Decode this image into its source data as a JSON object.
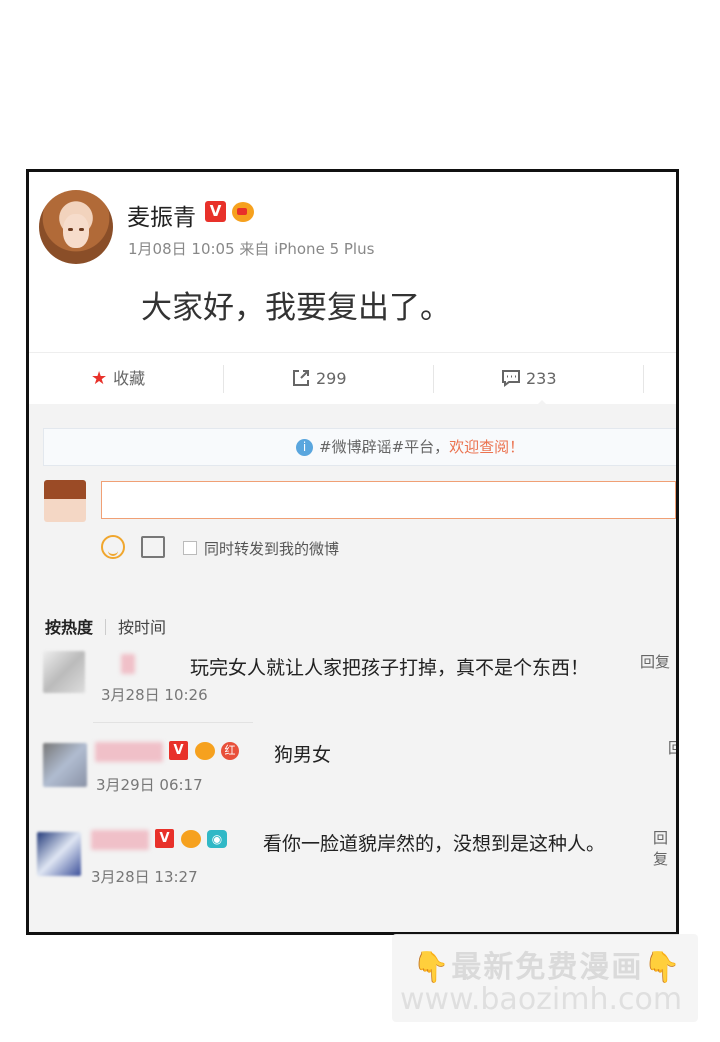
{
  "post": {
    "username": "麦振青",
    "verified_badge": "V",
    "meta": "1月08日 10:05 来自 iPhone 5 Plus",
    "text": "大家好，我要复出了。"
  },
  "actions": {
    "favorite_label": "收藏",
    "repost_count": "299",
    "comment_count": "233"
  },
  "notice": {
    "prefix": "#微博辟谣#平台，",
    "link": "欢迎查阅！"
  },
  "composer": {
    "sync_label": "同时转发到我的微博"
  },
  "sort": {
    "hot": "按热度",
    "time": "按时间"
  },
  "comments": [
    {
      "text": "玩完女人就让人家把孩子打掉，真不是个东西！",
      "time": "3月28日 10:26",
      "reply": "回复"
    },
    {
      "text": "狗男女",
      "time": "3月29日 06:17",
      "reply": "回"
    },
    {
      "text": "看你一脸道貌岸然的，没想到是这种人。",
      "time": "3月28日 13:27",
      "reply": "回复"
    }
  ],
  "badges": {
    "v": "V",
    "hong": "红",
    "cam": "◉"
  },
  "watermark": {
    "title": "👇最新免费漫画👇",
    "url": "www.baozimh.com"
  },
  "colors": {
    "brand_red": "#e8312a",
    "link_orange": "#eb7350",
    "input_border": "#f0a075"
  }
}
